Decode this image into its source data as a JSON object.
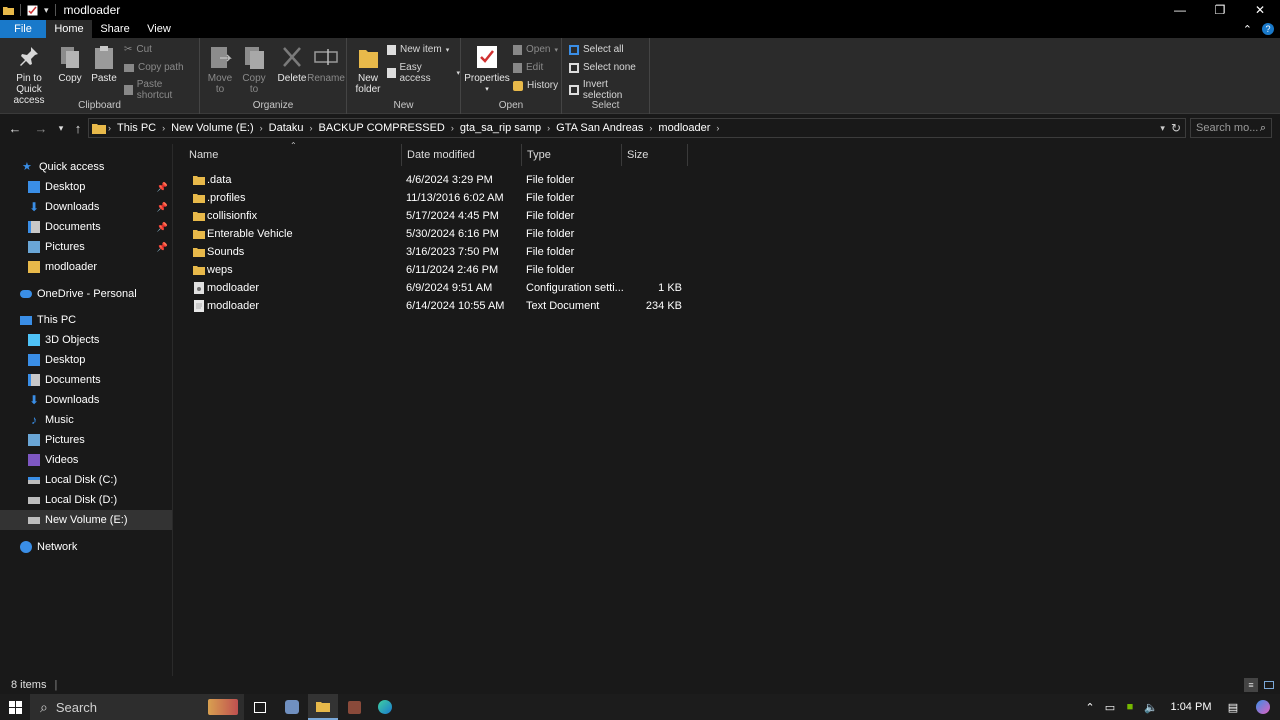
{
  "window": {
    "title": "modloader"
  },
  "ribbon_tabs": [
    {
      "label": "File"
    },
    {
      "label": "Home"
    },
    {
      "label": "Share"
    },
    {
      "label": "View"
    }
  ],
  "ribbon": {
    "clipboard": {
      "label": "Clipboard",
      "pin_line1": "Pin to Quick",
      "pin_line2": "access",
      "copy": "Copy",
      "paste": "Paste",
      "cut": "Cut",
      "copy_path": "Copy path",
      "paste_shortcut": "Paste shortcut"
    },
    "organize": {
      "label": "Organize",
      "move_line1": "Move",
      "move_line2": "to",
      "copy_line1": "Copy",
      "copy_line2": "to",
      "delete": "Delete",
      "rename": "Rename"
    },
    "new": {
      "label": "New",
      "new_folder_line1": "New",
      "new_folder_line2": "folder",
      "new_item": "New item",
      "easy_access": "Easy access"
    },
    "open": {
      "label": "Open",
      "properties": "Properties",
      "open": "Open",
      "edit": "Edit",
      "history": "History"
    },
    "select": {
      "label": "Select",
      "select_all": "Select all",
      "select_none": "Select none",
      "invert_selection": "Invert selection"
    }
  },
  "address": {
    "crumbs": [
      "This PC",
      "New Volume (E:)",
      "Dataku",
      "BACKUP COMPRESSED",
      "gta_sa_rip samp",
      "GTA San Andreas",
      "modloader"
    ],
    "search_placeholder": "Search mo..."
  },
  "nav": {
    "quick_access": "Quick access",
    "quick_items": [
      {
        "label": "Desktop",
        "pinned": true
      },
      {
        "label": "Downloads",
        "pinned": true
      },
      {
        "label": "Documents",
        "pinned": true
      },
      {
        "label": "Pictures",
        "pinned": true
      },
      {
        "label": "modloader",
        "pinned": false
      }
    ],
    "onedrive": "OneDrive - Personal",
    "this_pc": "This PC",
    "pc_items": [
      {
        "label": "3D Objects"
      },
      {
        "label": "Desktop"
      },
      {
        "label": "Documents"
      },
      {
        "label": "Downloads"
      },
      {
        "label": "Music"
      },
      {
        "label": "Pictures"
      },
      {
        "label": "Videos"
      },
      {
        "label": "Local Disk (C:)"
      },
      {
        "label": "Local Disk (D:)"
      },
      {
        "label": "New Volume (E:)"
      }
    ],
    "network": "Network",
    "selected": "New Volume (E:)"
  },
  "columns": {
    "name": "Name",
    "date": "Date modified",
    "type": "Type",
    "size": "Size"
  },
  "files": [
    {
      "name": ".data",
      "date": "4/6/2024 3:29 PM",
      "type": "File folder",
      "size": "",
      "kind": "folder"
    },
    {
      "name": ".profiles",
      "date": "11/13/2016 6:02 AM",
      "type": "File folder",
      "size": "",
      "kind": "folder"
    },
    {
      "name": "collisionfix",
      "date": "5/17/2024 4:45 PM",
      "type": "File folder",
      "size": "",
      "kind": "folder"
    },
    {
      "name": "Enterable Vehicle",
      "date": "5/30/2024 6:16 PM",
      "type": "File folder",
      "size": "",
      "kind": "folder"
    },
    {
      "name": "Sounds",
      "date": "3/16/2023 7:50 PM",
      "type": "File folder",
      "size": "",
      "kind": "folder"
    },
    {
      "name": "weps",
      "date": "6/11/2024 2:46 PM",
      "type": "File folder",
      "size": "",
      "kind": "folder"
    },
    {
      "name": "modloader",
      "date": "6/9/2024 9:51 AM",
      "type": "Configuration setti...",
      "size": "1 KB",
      "kind": "config"
    },
    {
      "name": "modloader",
      "date": "6/14/2024 10:55 AM",
      "type": "Text Document",
      "size": "234 KB",
      "kind": "text"
    }
  ],
  "status": {
    "items_count": "8 items"
  },
  "taskbar": {
    "search_label": "Search",
    "time": "1:04 PM"
  },
  "colors": {
    "accent": "#1979ca",
    "folder": "#e8b94a",
    "background": "#191919",
    "ribbon": "#2b2b2b"
  }
}
